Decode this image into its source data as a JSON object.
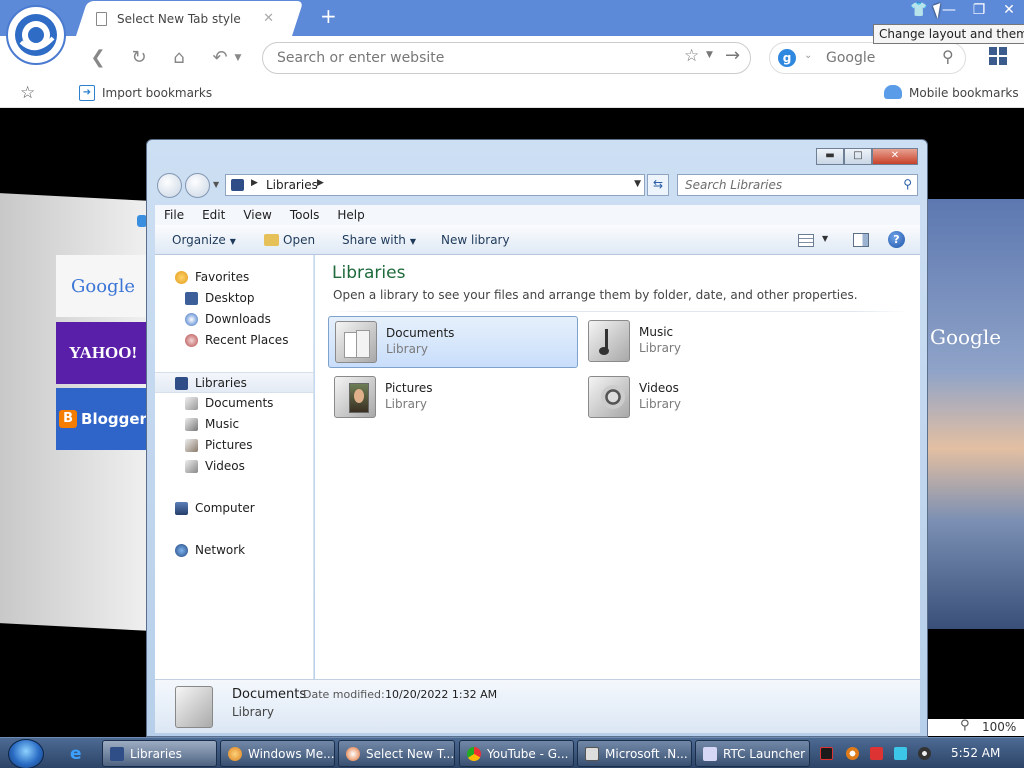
{
  "browser": {
    "tab_title": "Select New Tab style",
    "tab_close": "✕",
    "new_tab": "+",
    "window_controls": {
      "minimize": "—",
      "restore": "❐",
      "close": "✕",
      "theme": "👕"
    },
    "tooltip": "Change layout and theme",
    "address_placeholder": "Search or enter website",
    "search_engine_letter": "g",
    "search_placeholder": "Google",
    "bookmarks": {
      "import_label": "Import bookmarks",
      "mobile_label": "Mobile bookmarks"
    }
  },
  "newtab": {
    "tiles": {
      "google": "Google",
      "yahoo": "YAHOO!",
      "blogger_b": "B",
      "blogger": "Blogger"
    },
    "right_google": "Google",
    "zoom": "100%"
  },
  "explorer": {
    "path": "Libraries",
    "search_placeholder": "Search Libraries",
    "menu": [
      "File",
      "Edit",
      "View",
      "Tools",
      "Help"
    ],
    "commands": {
      "organize": "Organize",
      "open": "Open",
      "share_with": "Share with",
      "new_library": "New library"
    },
    "help_symbol": "?",
    "nav": {
      "favorites": "Favorites",
      "desktop": "Desktop",
      "downloads": "Downloads",
      "recent_places": "Recent Places",
      "libraries": "Libraries",
      "documents": "Documents",
      "music": "Music",
      "pictures": "Pictures",
      "videos": "Videos",
      "computer": "Computer",
      "network": "Network"
    },
    "content": {
      "title": "Libraries",
      "description": "Open a library to see your files and arrange them by folder, date, and other properties.",
      "items": [
        {
          "name": "Documents",
          "type": "Library"
        },
        {
          "name": "Music",
          "type": "Library"
        },
        {
          "name": "Pictures",
          "type": "Library"
        },
        {
          "name": "Videos",
          "type": "Library"
        }
      ]
    },
    "details": {
      "name": "Documents",
      "modified_label": "Date modified:",
      "modified_value": "10/20/2022 1:32 AM",
      "type": "Library"
    }
  },
  "taskbar": {
    "tasks": [
      "Libraries",
      "Windows Me...",
      "Select New T...",
      "YouTube - G...",
      "Microsoft .N...",
      "RTC Launcher"
    ],
    "clock": "5:52 AM"
  },
  "colors": {
    "browser_blue": "#5d8ad8",
    "library_title": "#1e6a3b",
    "taskbar": "#3a5780"
  }
}
